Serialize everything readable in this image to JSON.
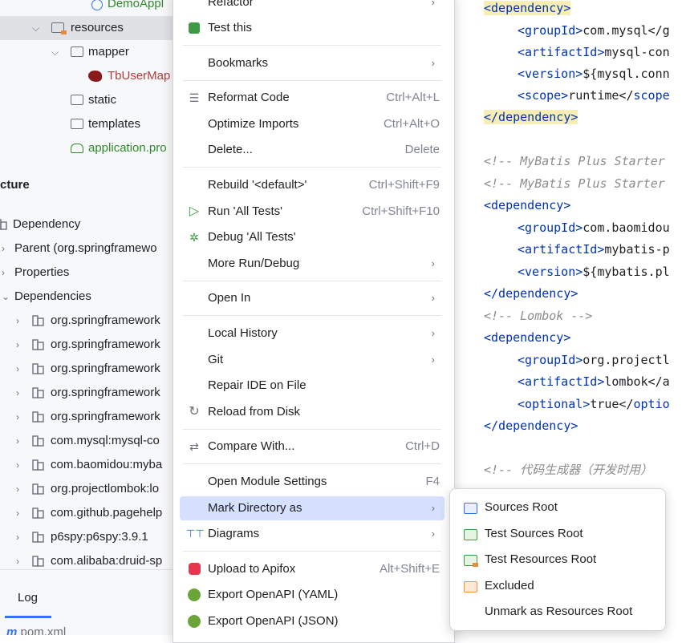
{
  "project_tree": {
    "items": [
      {
        "label": "DemoAppl",
        "kind": "file-green"
      },
      {
        "label": "resources",
        "kind": "folder-res"
      },
      {
        "label": "mapper",
        "kind": "folder"
      },
      {
        "label": "TbUserMap",
        "kind": "mybatis"
      },
      {
        "label": "static",
        "kind": "folder"
      },
      {
        "label": "templates",
        "kind": "folder"
      },
      {
        "label": "application.pro",
        "kind": "yaml"
      }
    ]
  },
  "structure": {
    "title": "cture",
    "items": [
      {
        "label": "Dependency"
      },
      {
        "label": "Parent (org.springframewo"
      },
      {
        "label": "Properties"
      },
      {
        "label": "Dependencies"
      },
      {
        "label": "org.springframework"
      },
      {
        "label": "org.springframework"
      },
      {
        "label": "org.springframework"
      },
      {
        "label": "org.springframework"
      },
      {
        "label": "org.springframework"
      },
      {
        "label": "com.mysql:mysql-co"
      },
      {
        "label": "com.baomidou:myba"
      },
      {
        "label": "org.projectlombok:lo"
      },
      {
        "label": "com.github.pagehelp"
      },
      {
        "label": "p6spy:p6spy:3.9.1"
      },
      {
        "label": "com.alibaba:druid-sp"
      }
    ]
  },
  "bottom": {
    "log_tab": "Log",
    "file_tab": "pom.xml"
  },
  "context_menu": {
    "refactor": "Refactor",
    "test_this": "Test this",
    "bookmarks": "Bookmarks",
    "reformat": "Reformat Code",
    "reformat_sc": "Ctrl+Alt+L",
    "optimize": "Optimize Imports",
    "optimize_sc": "Ctrl+Alt+O",
    "delete": "Delete...",
    "delete_sc": "Delete",
    "rebuild": "Rebuild '<default>'",
    "rebuild_sc": "Ctrl+Shift+F9",
    "run": "Run 'All Tests'",
    "run_sc": "Ctrl+Shift+F10",
    "debug": "Debug 'All Tests'",
    "more_run": "More Run/Debug",
    "open_in": "Open In",
    "local_history": "Local History",
    "git": "Git",
    "repair": "Repair IDE on File",
    "reload": "Reload from Disk",
    "compare": "Compare With...",
    "compare_sc": "Ctrl+D",
    "module_settings": "Open Module Settings",
    "module_settings_sc": "F4",
    "mark_dir": "Mark Directory as",
    "diagrams": "Diagrams",
    "apifox": "Upload to Apifox",
    "apifox_sc": "Alt+Shift+E",
    "openapi_yaml": "Export OpenAPI (YAML)",
    "openapi_json": "Export OpenAPI (JSON)"
  },
  "submenu": {
    "sources_root": "Sources Root",
    "test_sources_root": "Test Sources Root",
    "test_resources_root": "Test Resources Root",
    "excluded": "Excluded",
    "unmark": "Unmark as Resources Root"
  },
  "editor": {
    "l1_open": "<dependency>",
    "l2_tag": "<groupId>",
    "l2_text": "com.mysql</g",
    "l3_tag": "<artifactId>",
    "l3_text": "mysql-con",
    "l4_tag": "<version>",
    "l4_text": "${mysql.conn",
    "l5_tag": "<scope>",
    "l5_text": "runtime</",
    "l5_tag2": "scope",
    "l6": "</dependency>",
    "c1": "<!-- MyBatis Plus Starter",
    "c2": "<!-- MyBatis Plus Starter",
    "l7": "<dependency>",
    "l8_tag": "<groupId>",
    "l8_text": "com.baomidou",
    "l9_tag": "<artifactId>",
    "l9_text": "mybatis-p",
    "l10_tag": "<version>",
    "l10_text": "${mybatis.pl",
    "l11": "</dependency>",
    "c3": "<!-- Lombok -->",
    "l12": "<dependency>",
    "l13_tag": "<groupId>",
    "l13_text": "org.projectl",
    "l14_tag": "<artifactId>",
    "l14_text": "lombok</a",
    "l15_tag": "<optional>",
    "l15_text": "true</",
    "l15_tag2": "optio",
    "l16": "</dependency>",
    "c4": "<!-- 代码生成器（开发时用）"
  }
}
